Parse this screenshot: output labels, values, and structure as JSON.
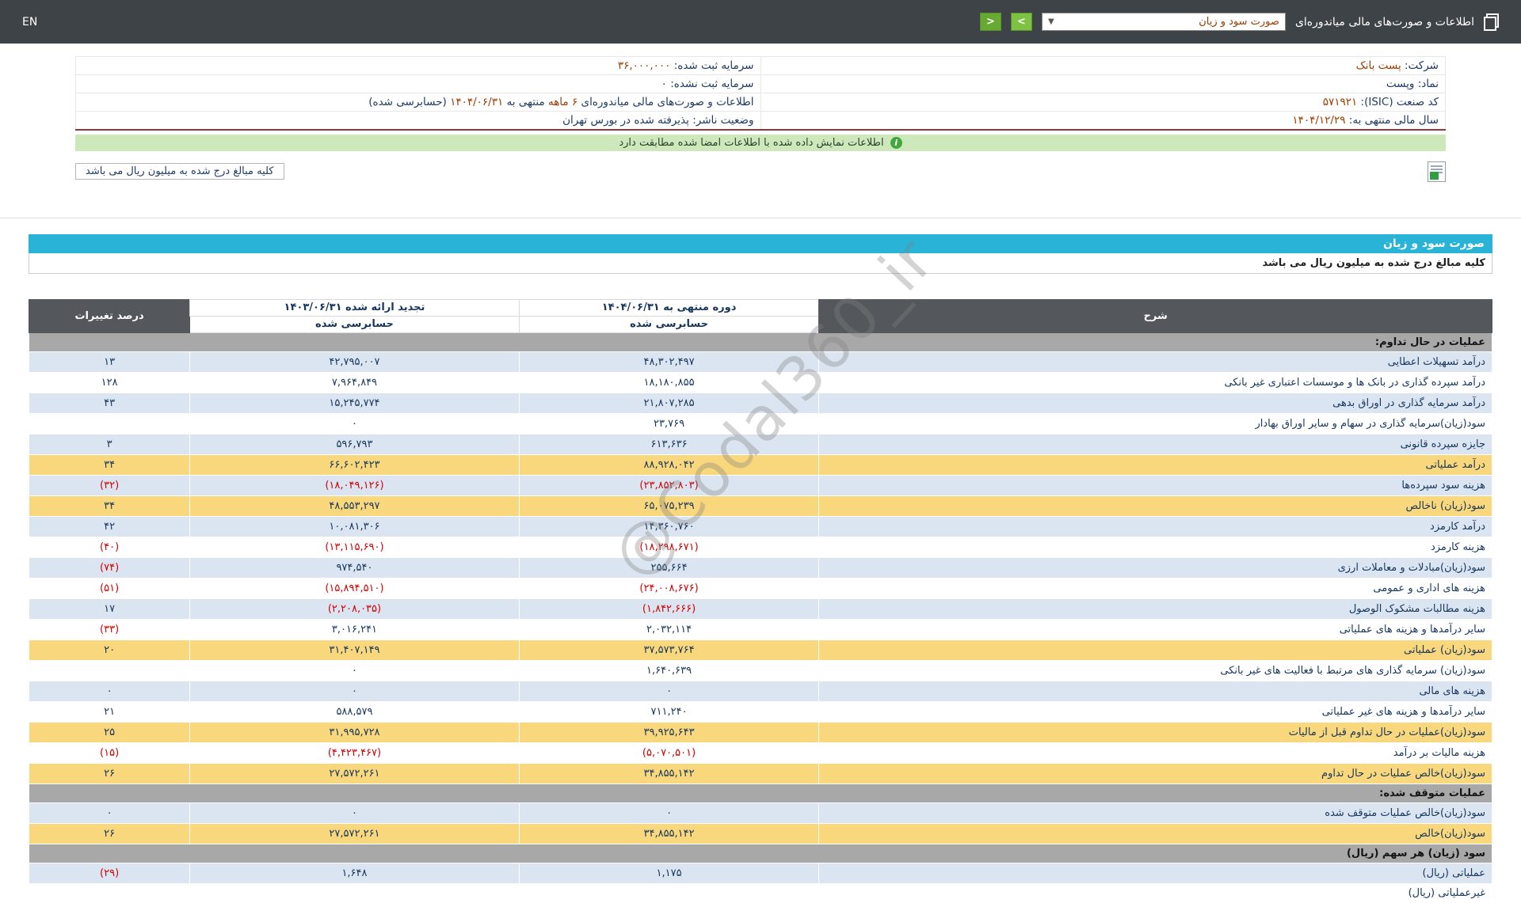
{
  "topbar": {
    "en_label": "EN",
    "title": "اطلاعات و صورت‌های مالی میاندوره‌ای",
    "select_value": "صورت سود و زیان",
    "next_label": ">",
    "prev_label": "<"
  },
  "company": {
    "rows": [
      {
        "r_label": "شرکت:",
        "r_value": "پست بانک",
        "l_label": "سرمایه ثبت شده:",
        "l_value": "۳۶,۰۰۰,۰۰۰"
      },
      {
        "r_label": "نماد:",
        "r_value": "وپست",
        "l_label": "سرمایه ثبت نشده:",
        "l_value": "۰"
      },
      {
        "r_label": "کد صنعت (ISIC):",
        "r_value": "۵۷۱۹۲۱"
      },
      {
        "r_label": "سال مالی منتهی به:",
        "r_value": "۱۴۰۴/۱۲/۲۹",
        "l_label": "وضعیت ناشر:",
        "l_value": "پذیرفته شده در بورس تهران"
      }
    ],
    "period_row": {
      "p1": "اطلاعات و صورت‌های مالی میاندوره‌ای",
      "p2": "۶ ماهه",
      "p3": "منتهی به",
      "p4": "۱۴۰۴/۰۶/۳۱",
      "p5": "(حسابرسی شده)"
    }
  },
  "banner": {
    "text": "اطلاعات نمایش داده شده با اطلاعات امضا شده مطابقت دارد"
  },
  "note_box": {
    "text": "کلیه مبالغ درج شده به میلیون ریال می باشد"
  },
  "watermark": {
    "text": "@Codal360_ir"
  },
  "statement": {
    "title": "صورت سود و زیان",
    "unit_note": "کلیه مبالغ درج شده به میلیون ریال می باشد",
    "col_desc": "شرح",
    "col_current": "دوره منتهی به ۱۴۰۴/۰۶/۳۱",
    "col_prior": "تجدید ارائه شده ۱۴۰۳/۰۶/۳۱",
    "col_audited": "حسابرسی شده",
    "col_change": "درصد تغییرات",
    "rows": [
      {
        "type": "section",
        "desc": "عملیات در حال تداوم:"
      },
      {
        "type": "data",
        "shade": "blue",
        "desc": "درآمد تسهیلات اعطایی",
        "current": "۴۸,۳۰۲,۴۹۷",
        "prior": "۴۲,۷۹۵,۰۰۷",
        "change": "۱۳"
      },
      {
        "type": "data",
        "shade": "white",
        "desc": "درآمد سپرده گذاری در بانک ها و موسسات اعتباری غیر بانکی",
        "current": "۱۸,۱۸۰,۸۵۵",
        "prior": "۷,۹۶۴,۸۴۹",
        "change": "۱۲۸"
      },
      {
        "type": "data",
        "shade": "blue",
        "desc": "درآمد سرمایه گذاری در اوراق بدهی",
        "current": "۲۱,۸۰۷,۲۸۵",
        "prior": "۱۵,۲۴۵,۷۷۴",
        "change": "۴۳"
      },
      {
        "type": "data",
        "shade": "white",
        "desc": "سود(زیان)سرمایه گذاری در سهام و سایر اوراق بهادار",
        "current": "۲۳,۷۶۹",
        "prior": "۰",
        "change": ""
      },
      {
        "type": "data",
        "shade": "blue",
        "desc": "جایزه سپرده قانونی",
        "current": "۶۱۳,۶۳۶",
        "prior": "۵۹۶,۷۹۳",
        "change": "۳"
      },
      {
        "type": "data",
        "shade": "yellow",
        "desc": "درآمد عملیاتی",
        "current": "۸۸,۹۲۸,۰۴۲",
        "prior": "۶۶,۶۰۲,۴۲۳",
        "change": "۳۴"
      },
      {
        "type": "data",
        "shade": "blue",
        "desc": "هزینه سود سپرده‌ها",
        "current": "(۲۳,۸۵۲,۸۰۳)",
        "prior": "(۱۸,۰۴۹,۱۲۶)",
        "change": "(۳۲)"
      },
      {
        "type": "data",
        "shade": "yellow",
        "desc": "سود(زیان) ناخالص",
        "current": "۶۵,۰۷۵,۲۳۹",
        "prior": "۴۸,۵۵۳,۲۹۷",
        "change": "۳۴"
      },
      {
        "type": "data",
        "shade": "blue",
        "desc": "درآمد کارمزد",
        "current": "۱۴,۳۶۰,۷۶۰",
        "prior": "۱۰,۰۸۱,۳۰۶",
        "change": "۴۲"
      },
      {
        "type": "data",
        "shade": "white",
        "desc": "هزینه کارمزد",
        "current": "(۱۸,۲۹۸,۶۷۱)",
        "prior": "(۱۳,۱۱۵,۶۹۰)",
        "change": "(۴۰)"
      },
      {
        "type": "data",
        "shade": "blue",
        "desc": "سود(زیان)مبادلات و معاملات ارزی",
        "current": "۲۵۵,۶۶۴",
        "prior": "۹۷۴,۵۴۰",
        "change": "(۷۴)"
      },
      {
        "type": "data",
        "shade": "white",
        "desc": "هزینه های اداری و عمومی",
        "current": "(۲۴,۰۰۸,۶۷۶)",
        "prior": "(۱۵,۸۹۴,۵۱۰)",
        "change": "(۵۱)"
      },
      {
        "type": "data",
        "shade": "blue",
        "desc": "هزینه مطالبات مشکوک الوصول",
        "current": "(۱,۸۴۲,۶۶۶)",
        "prior": "(۲,۲۰۸,۰۳۵)",
        "change": "۱۷"
      },
      {
        "type": "data",
        "shade": "white",
        "desc": "سایر درآمدها و هزینه های عملیاتی",
        "current": "۲,۰۳۲,۱۱۴",
        "prior": "۳,۰۱۶,۲۴۱",
        "change": "(۳۳)"
      },
      {
        "type": "data",
        "shade": "yellow",
        "desc": "سود(زیان) عملیاتی",
        "current": "۳۷,۵۷۳,۷۶۴",
        "prior": "۳۱,۴۰۷,۱۴۹",
        "change": "۲۰"
      },
      {
        "type": "data",
        "shade": "white",
        "desc": "سود(زیان) سرمایه گذاری های مرتبط با فعالیت های غیر بانکی",
        "current": "۱,۶۴۰,۶۳۹",
        "prior": "۰",
        "change": ""
      },
      {
        "type": "data",
        "shade": "blue",
        "desc": "هزینه های مالی",
        "current": "۰",
        "prior": "۰",
        "change": "۰"
      },
      {
        "type": "data",
        "shade": "white",
        "desc": "سایر درآمدها و هزینه های غیر عملیاتی",
        "current": "۷۱۱,۲۴۰",
        "prior": "۵۸۸,۵۷۹",
        "change": "۲۱"
      },
      {
        "type": "data",
        "shade": "yellow",
        "desc": "سود(زیان)عملیات در حال تداوم قبل از مالیات",
        "current": "۳۹,۹۲۵,۶۴۳",
        "prior": "۳۱,۹۹۵,۷۲۸",
        "change": "۲۵"
      },
      {
        "type": "data",
        "shade": "white",
        "desc": "هزینه مالیات بر درآمد",
        "current": "(۵,۰۷۰,۵۰۱)",
        "prior": "(۴,۴۲۳,۴۶۷)",
        "change": "(۱۵)"
      },
      {
        "type": "data",
        "shade": "yellow",
        "desc": "سود(زیان)خالص عملیات در حال تداوم",
        "current": "۳۴,۸۵۵,۱۴۲",
        "prior": "۲۷,۵۷۲,۲۶۱",
        "change": "۲۶"
      },
      {
        "type": "section",
        "desc": "عملیات متوقف شده:"
      },
      {
        "type": "data",
        "shade": "blue",
        "desc": "سود(زیان)خالص عملیات متوقف شده",
        "current": "۰",
        "prior": "۰",
        "change": "۰"
      },
      {
        "type": "data",
        "shade": "yellow",
        "desc": "سود(زیان)خالص",
        "current": "۳۴,۸۵۵,۱۴۲",
        "prior": "۲۷,۵۷۲,۲۶۱",
        "change": "۲۶"
      },
      {
        "type": "section",
        "desc": "سود (زیان) هر سهم (ریال)"
      },
      {
        "type": "data",
        "shade": "blue",
        "desc": "عملیاتی (ریال)",
        "current": "۱,۱۷۵",
        "prior": "۱,۶۴۸",
        "change": "(۲۹)"
      },
      {
        "type": "data",
        "shade": "white",
        "desc": "غیرعملیاتی (ریال)",
        "current": "",
        "prior": "",
        "change": ""
      }
    ]
  }
}
